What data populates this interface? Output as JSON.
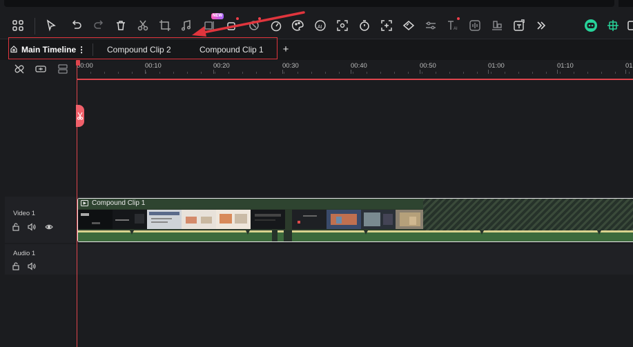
{
  "toolbar": {
    "new_badge": "NEW",
    "icons": [
      "grid-icon",
      "pointer-icon",
      "undo-icon",
      "redo-icon",
      "delete-icon",
      "cut-icon",
      "crop-icon",
      "audio-icon",
      "split-icon",
      "keyframe-icon",
      "mask-icon",
      "speed-icon",
      "color-icon",
      "ai-icon",
      "screenshot-icon",
      "timer-icon",
      "add-marker-icon",
      "motion-icon",
      "adjust-icon",
      "text-ai-icon",
      "voice-icon",
      "align-icon",
      "export-icon",
      "more-icon",
      "ai-assistant-icon",
      "render-icon",
      "settings-icon"
    ]
  },
  "tabs": {
    "main": "Main Timeline",
    "main_menu": "⋮",
    "compound2": "Compound Clip 2",
    "compound1": "Compound Clip 1",
    "add": "+"
  },
  "ruler": {
    "labels": [
      "00:00",
      "00:10",
      "00:20",
      "00:30",
      "00:40",
      "00:50",
      "01:00",
      "01:10",
      "01"
    ]
  },
  "tracks": {
    "video_label": "Video 1",
    "audio_label": "Audio 1"
  },
  "clip": {
    "title": "Compound Clip 1"
  },
  "colors": {
    "accent_red": "#e0454d",
    "clip_green": "#3c6a3c",
    "assistant_green": "#27d39a"
  }
}
